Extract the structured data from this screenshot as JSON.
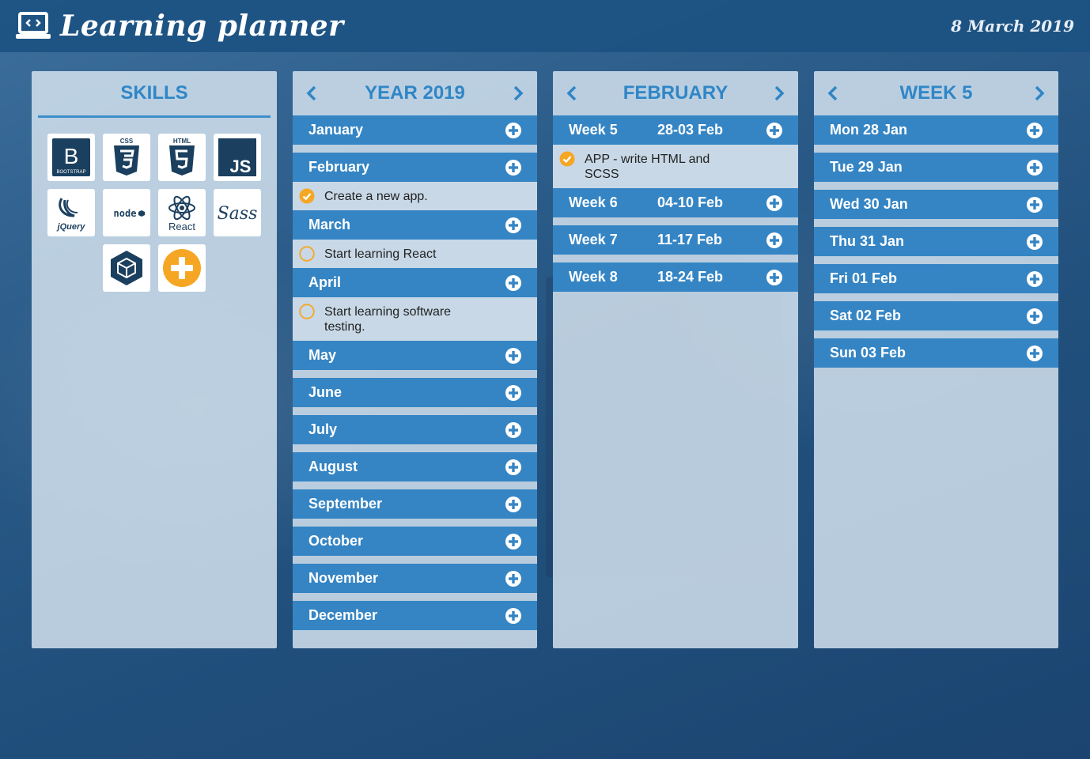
{
  "app": {
    "title": "Learning planner",
    "date": "8 March 2019"
  },
  "skills": {
    "header": "SKILLS",
    "items": [
      {
        "name": "bootstrap",
        "caption": "BOOTSTRAP"
      },
      {
        "name": "css3",
        "caption": "CSS"
      },
      {
        "name": "html5",
        "caption": "HTML"
      },
      {
        "name": "javascript",
        "caption": "JS"
      },
      {
        "name": "jquery",
        "caption": "jQuery"
      },
      {
        "name": "nodejs",
        "caption": "node"
      },
      {
        "name": "react",
        "caption": "React"
      },
      {
        "name": "sass",
        "caption": "Sass"
      },
      {
        "name": "webpack",
        "caption": ""
      },
      {
        "name": "add-skill",
        "caption": ""
      }
    ]
  },
  "year": {
    "header": "YEAR 2019",
    "months": [
      {
        "label": "January",
        "tasks": []
      },
      {
        "label": "February",
        "tasks": [
          {
            "text": "Create a new app.",
            "done": true
          }
        ]
      },
      {
        "label": "March",
        "tasks": [
          {
            "text": "Start learning React",
            "done": false
          }
        ]
      },
      {
        "label": "April",
        "tasks": [
          {
            "text": "Start learning software testing.",
            "done": false
          }
        ]
      },
      {
        "label": "May",
        "tasks": []
      },
      {
        "label": "June",
        "tasks": []
      },
      {
        "label": "July",
        "tasks": []
      },
      {
        "label": "August",
        "tasks": []
      },
      {
        "label": "September",
        "tasks": []
      },
      {
        "label": "October",
        "tasks": []
      },
      {
        "label": "November",
        "tasks": []
      },
      {
        "label": "December",
        "tasks": []
      }
    ]
  },
  "month": {
    "header": "FEBRUARY",
    "weeks": [
      {
        "label": "Week 5",
        "range": "28-03 Feb",
        "tasks": [
          {
            "text": "APP - write HTML and SCSS",
            "done": true
          }
        ]
      },
      {
        "label": "Week 6",
        "range": "04-10 Feb",
        "tasks": []
      },
      {
        "label": "Week 7",
        "range": "11-17 Feb",
        "tasks": []
      },
      {
        "label": "Week 8",
        "range": "18-24 Feb",
        "tasks": []
      }
    ]
  },
  "week": {
    "header": "WEEK 5",
    "days": [
      {
        "label": "Mon 28 Jan"
      },
      {
        "label": "Tue 29 Jan"
      },
      {
        "label": "Wed 30 Jan"
      },
      {
        "label": "Thu 31 Jan"
      },
      {
        "label": "Fri 01 Feb"
      },
      {
        "label": "Sat 02 Feb"
      },
      {
        "label": "Sun 03 Feb"
      }
    ]
  },
  "colors": {
    "accent": "#3585c4",
    "header_text": "#2f86c6",
    "done": "#f5a623",
    "panel_bg": "#d2e1ee"
  }
}
